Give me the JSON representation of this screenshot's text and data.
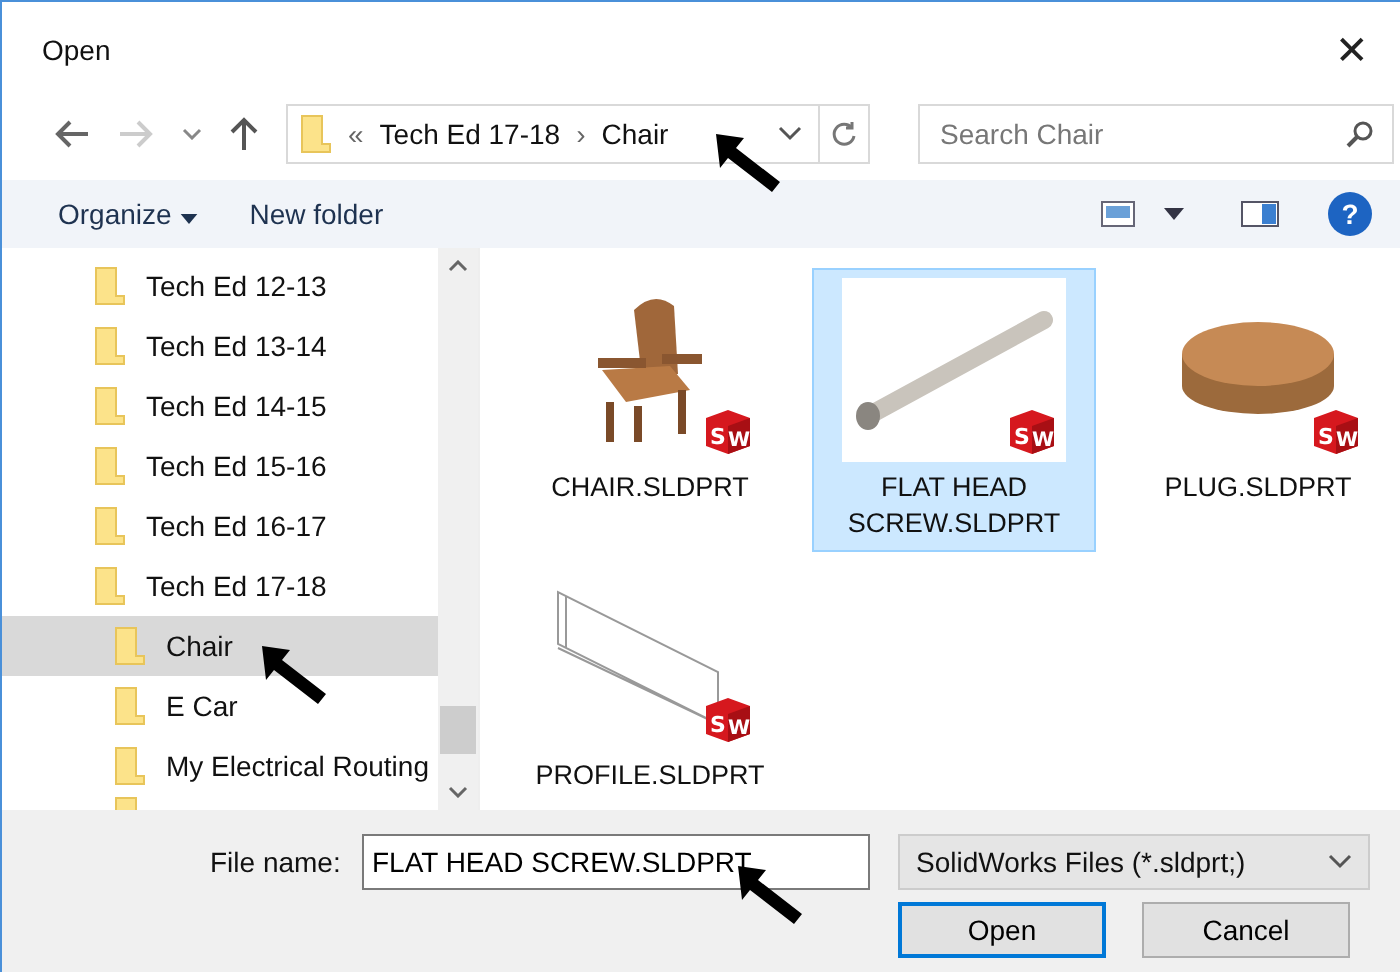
{
  "window": {
    "title": "Open",
    "close": "✕"
  },
  "address": {
    "overflow": "«",
    "crumbs": [
      "Tech Ed 17-18",
      "Chair"
    ],
    "separator": "›"
  },
  "search": {
    "placeholder": "Search Chair"
  },
  "toolbar": {
    "organize": "Organize",
    "new_folder": "New folder",
    "help": "?"
  },
  "tree": [
    {
      "label": "Tech Ed 12-13",
      "selected": false
    },
    {
      "label": "Tech Ed 13-14",
      "selected": false
    },
    {
      "label": "Tech Ed 14-15",
      "selected": false
    },
    {
      "label": "Tech Ed 15-16",
      "selected": false
    },
    {
      "label": "Tech Ed 16-17",
      "selected": false
    },
    {
      "label": "Tech Ed 17-18",
      "selected": false,
      "children": [
        {
          "label": "Chair",
          "selected": true
        },
        {
          "label": "E Car",
          "selected": false
        },
        {
          "label": "My Electrical Routing",
          "selected": false
        }
      ]
    }
  ],
  "files": [
    {
      "name": "CHAIR.SLDPRT",
      "kind": "chair",
      "selected": false,
      "badge_letters": [
        "S",
        "W"
      ]
    },
    {
      "name": "FLAT HEAD SCREW.SLDPRT",
      "kind": "screw",
      "selected": true,
      "badge_letters": [
        "S",
        "W"
      ]
    },
    {
      "name": "PLUG.SLDPRT",
      "kind": "plug",
      "selected": false,
      "badge_letters": [
        "S",
        "W"
      ]
    },
    {
      "name": "PROFILE.SLDPRT",
      "kind": "profile",
      "selected": false,
      "badge_letters": [
        "S",
        "W"
      ]
    }
  ],
  "file_name": {
    "label": "File name:",
    "value": "FLAT HEAD SCREW.SLDPRT"
  },
  "file_type": {
    "value": "SolidWorks Files (*.sldprt;)"
  },
  "buttons": [
    {
      "label": "Open",
      "default": true
    },
    {
      "label": "Cancel",
      "default": false
    }
  ]
}
